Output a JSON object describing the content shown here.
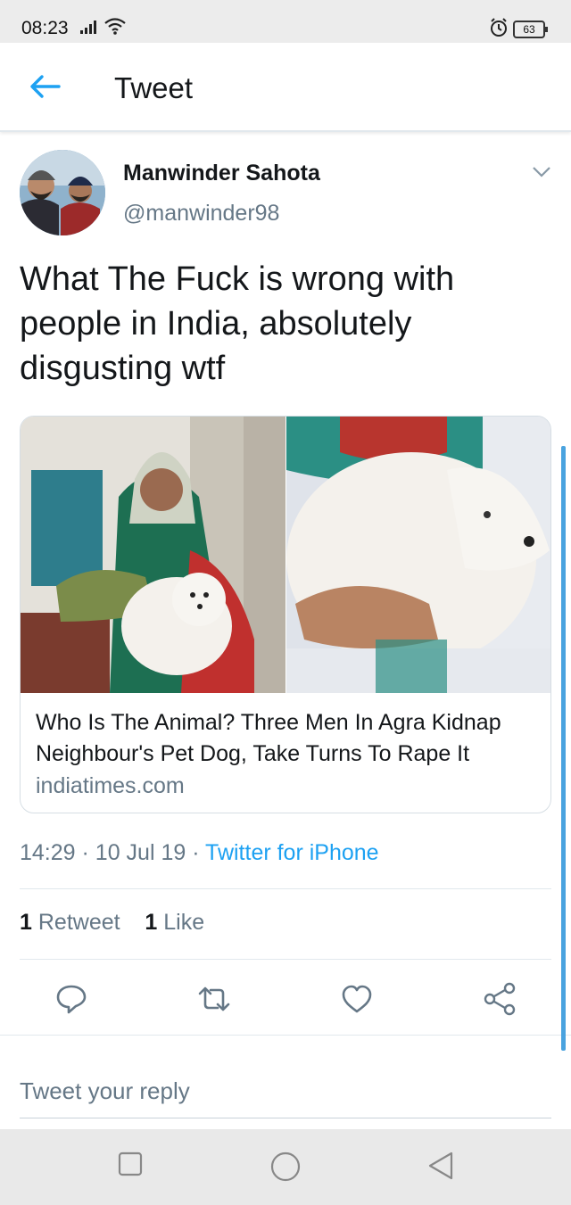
{
  "status_bar": {
    "time": "08:23",
    "battery": "63",
    "icons": [
      "signal-icon",
      "wifi-icon",
      "alarm-icon",
      "battery-icon"
    ]
  },
  "app_bar": {
    "title": "Tweet",
    "back_icon": "arrow-left-icon",
    "accent_color": "#1da1f2"
  },
  "tweet": {
    "author_name": "Manwinder Sahota",
    "author_handle": "@manwinder98",
    "text": "What The Fuck is wrong with people in India, absolutely disgusting wtf",
    "card": {
      "headline": "Who Is The Animal? Three Men In Agra Kidnap Neighbour's Pet Dog, Take Turns To Rape It",
      "domain": "indiatimes.com"
    },
    "time": "14:29",
    "date": "10 Jul 19",
    "separator": "·",
    "source": "Twitter for iPhone",
    "retweets": {
      "count": "1",
      "label": "Retweet"
    },
    "likes": {
      "count": "1",
      "label": "Like"
    }
  },
  "actions": [
    "reply-icon",
    "retweet-icon",
    "like-icon",
    "share-icon"
  ],
  "reply": {
    "placeholder": "Tweet your reply"
  },
  "nav_bar": [
    "recents-icon",
    "home-icon",
    "back-icon"
  ],
  "colors": {
    "secondary_text": "#657786",
    "divider": "#e1e8ed"
  }
}
